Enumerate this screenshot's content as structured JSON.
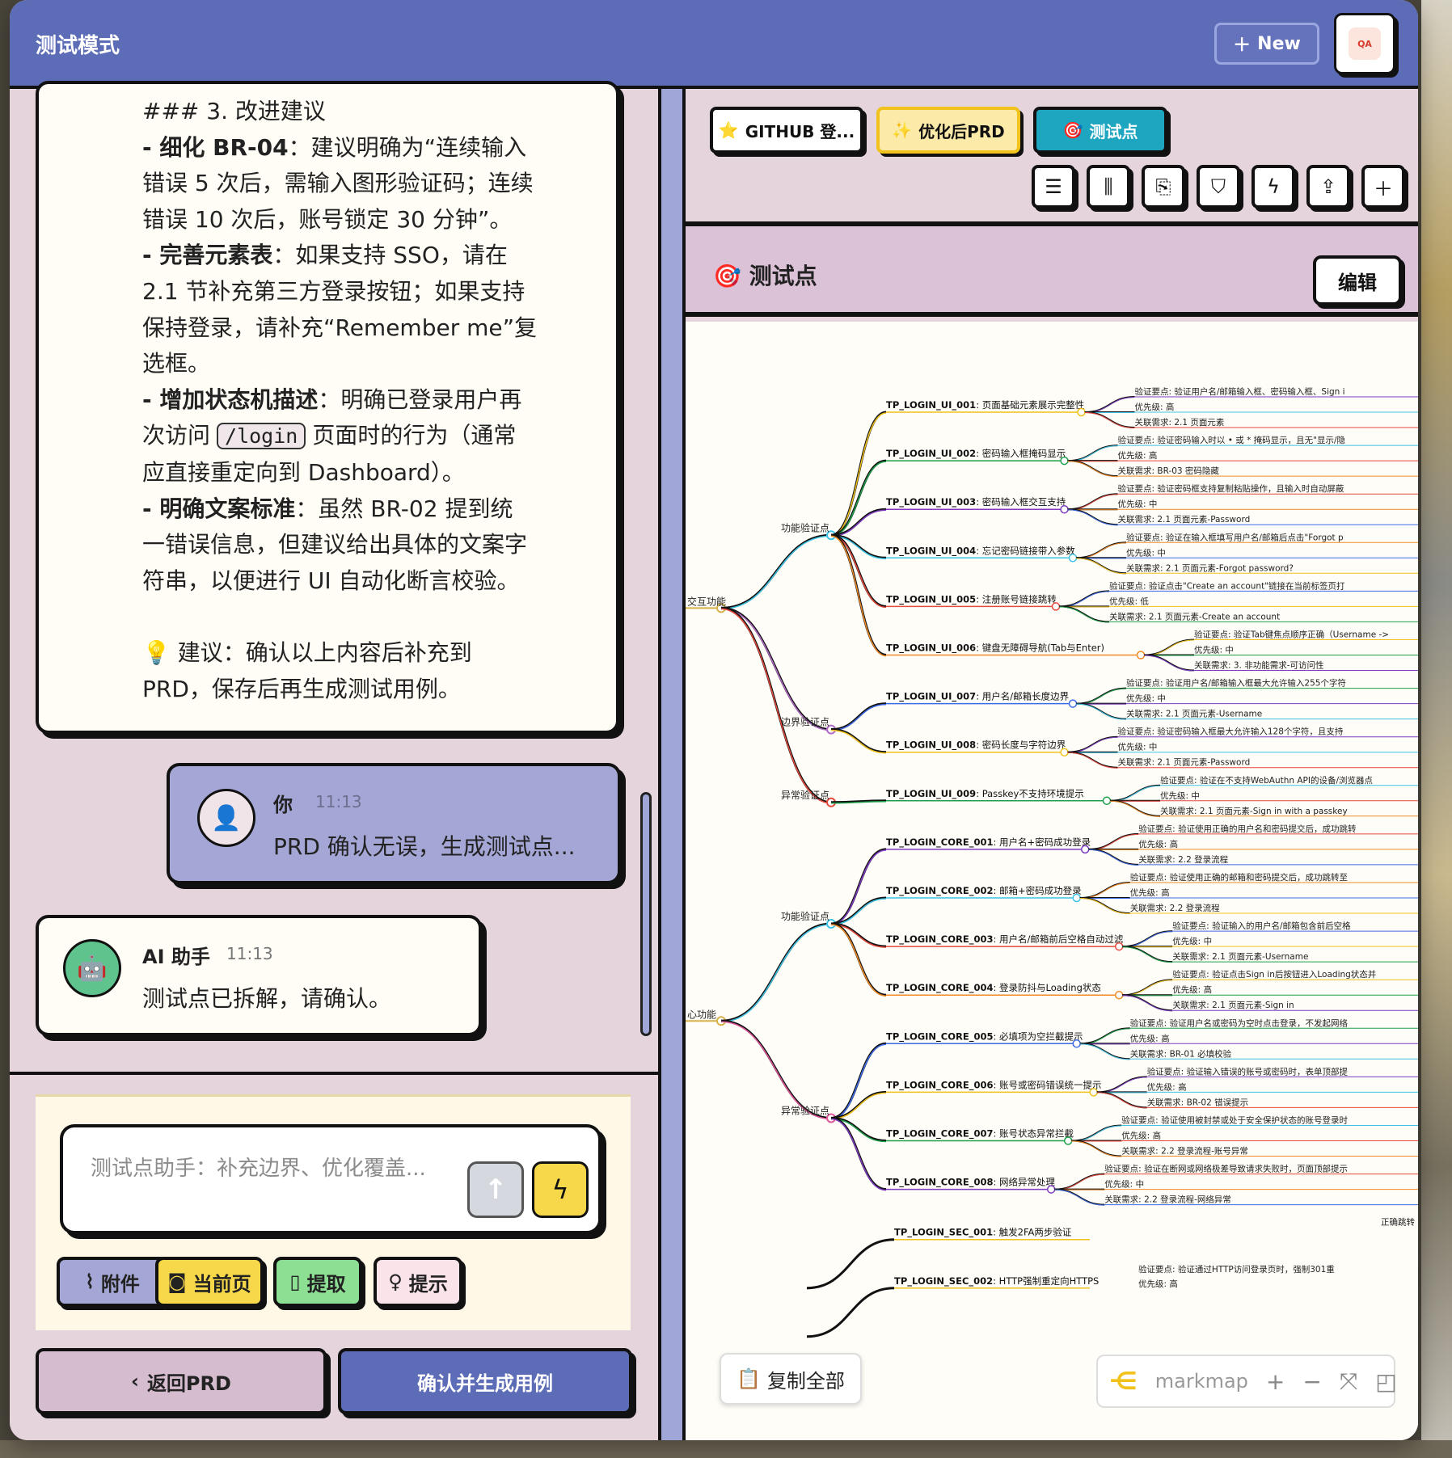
{
  "header": {
    "title": "测试模式",
    "new_label": "New",
    "avatar_text": "QA"
  },
  "chat": {
    "big_message_lines": [
      {
        "bold": "",
        "rest": "### 3. 改进建议"
      },
      {
        "bold": "- 细化 BR-04",
        "rest": "：建议明确为“连续输入"
      },
      {
        "bold": "",
        "rest": "错误 5 次后，需输入图形验证码；连续"
      },
      {
        "bold": "",
        "rest": "错误 10 次后，账号锁定 30 分钟”。"
      },
      {
        "bold": "- 完善元素表",
        "rest": "：如果支持 SSO，请在"
      },
      {
        "bold": "",
        "rest": "2.1 节补充第三方登录按钮；如果支持"
      },
      {
        "bold": "",
        "rest": "保持登录，请补充“Remember me”复"
      },
      {
        "bold": "",
        "rest": "选框。"
      },
      {
        "bold": "- 增加状态机描述",
        "rest": "：明确已登录用户再"
      },
      {
        "bold": "",
        "rest": ""
      },
      {
        "bold": "",
        "rest": "应直接重定向到 Dashboard）。"
      },
      {
        "bold": "- 明确文案标准",
        "rest": "：虽然 BR-02 提到统"
      },
      {
        "bold": "",
        "rest": "一错误信息，但建议给出具体的文案字"
      },
      {
        "bold": "",
        "rest": "符串，以便进行 UI 自动化断言校验。"
      },
      {
        "bold": "",
        "rest": " "
      },
      {
        "bold": "",
        "rest": "💡 建议：确认以上内容后补充到"
      },
      {
        "bold": "",
        "rest": "PRD，保存后再生成测试用例。"
      }
    ],
    "line10_pre": "次访问",
    "line10_code": "/login",
    "line10_post": "页面时的行为（通常",
    "user_message": {
      "name": "你",
      "time": "11:13",
      "text": "PRD 确认无误，生成测试点..."
    },
    "ai_message": {
      "name": "AI 助手",
      "time": "11:13",
      "text": "测试点已拆解，请确认。"
    },
    "composer_placeholder": "测试点助手：补充边界、优化覆盖...",
    "tools": [
      "附件",
      "当前页",
      "提取",
      "提示"
    ],
    "back_label": "返回PRD",
    "confirm_label": "确认并生成用例"
  },
  "right": {
    "tabs": [
      "GITHUB 登...",
      "优化后PRD",
      "测试点"
    ],
    "section_title": "测试点",
    "edit_label": "编辑",
    "copy_all_label": "复制全部",
    "markmap_label": "markmap"
  },
  "mindmap": {
    "groups": [
      {
        "label": "交互功能",
        "categories": [
          {
            "label": "功能验证点",
            "color": "#3cc3e5",
            "nodes": [
              {
                "id": "TP_LOGIN_UI_001",
                "title": "页面基础元素展示完整性",
                "detail": "验证要点: 验证用户名/邮箱输入框、密码输入框、Sign i",
                "priority": "优先级: 高",
                "req": "关联需求: 2.1 页面元素"
              },
              {
                "id": "TP_LOGIN_UI_002",
                "title": "密码输入框掩码显示",
                "detail": "验证要点: 验证密码输入时以 • 或 * 掩码显示，且无\"显示/隐",
                "priority": "优先级: 高",
                "req": "关联需求: BR-03 密码隐藏"
              },
              {
                "id": "TP_LOGIN_UI_003",
                "title": "密码输入框交互支持",
                "detail": "验证要点: 验证密码框支持复制粘贴操作，且输入时自动屏蔽",
                "priority": "优先级: 中",
                "req": "关联需求: 2.1 页面元素-Password"
              },
              {
                "id": "TP_LOGIN_UI_004",
                "title": "忘记密码链接带入参数",
                "detail": "验证要点: 验证在输入框填写用户名/邮箱后点击\"Forgot p",
                "priority": "优先级: 中",
                "req": "关联需求: 2.1 页面元素-Forgot password?"
              },
              {
                "id": "TP_LOGIN_UI_005",
                "title": "注册账号链接跳转",
                "detail": "验证要点: 验证点击\"Create an account\"链接在当前标签页打",
                "priority": "优先级: 低",
                "req": "关联需求: 2.1 页面元素-Create an account"
              },
              {
                "id": "TP_LOGIN_UI_006",
                "title": "键盘无障碍导航(Tab与Enter)",
                "detail": "验证要点: 验证Tab键焦点顺序正确（Username ->",
                "priority": "优先级: 中",
                "req": "关联需求: 3. 非功能需求-可访问性"
              }
            ]
          },
          {
            "label": "边界验证点",
            "color": "#b06ac6",
            "nodes": [
              {
                "id": "TP_LOGIN_UI_007",
                "title": "用户名/邮箱长度边界",
                "detail": "验证要点: 验证用户名/邮箱输入框最大允许输入255个字符",
                "priority": "优先级: 中",
                "req": "关联需求: 2.1 页面元素-Username"
              },
              {
                "id": "TP_LOGIN_UI_008",
                "title": "密码长度与字符边界",
                "detail": "验证要点: 验证密码输入框最大允许输入128个字符，且支持",
                "priority": "优先级: 中",
                "req": "关联需求: 2.1 页面元素-Password"
              }
            ]
          },
          {
            "label": "异常验证点",
            "color": "#e5483c",
            "nodes": [
              {
                "id": "TP_LOGIN_UI_009",
                "title": "Passkey不支持环境提示",
                "detail": "验证要点: 验证在不支持WebAuthn API的设备/浏览器点",
                "priority": "优先级: 中",
                "req": "关联需求: 2.1 页面元素-Sign in with a passkey"
              }
            ]
          }
        ]
      },
      {
        "label": "心功能",
        "categories": [
          {
            "label": "功能验证点",
            "color": "#3cc3e5",
            "nodes": [
              {
                "id": "TP_LOGIN_CORE_001",
                "title": "用户名+密码成功登录",
                "detail": "验证要点: 验证使用正确的用户名和密码提交后，成功跳转",
                "priority": "优先级: 高",
                "req": "关联需求: 2.2 登录流程"
              },
              {
                "id": "TP_LOGIN_CORE_002",
                "title": "邮箱+密码成功登录",
                "detail": "验证要点: 验证使用正确的邮箱和密码提交后，成功跳转至",
                "priority": "优先级: 高",
                "req": "关联需求: 2.2 登录流程"
              },
              {
                "id": "TP_LOGIN_CORE_003",
                "title": "用户名/邮箱前后空格自动过滤",
                "detail": "验证要点: 验证输入的用户名/邮箱包含前后空格",
                "priority": "优先级: 中",
                "req": "关联需求: 2.1 页面元素-Username"
              },
              {
                "id": "TP_LOGIN_CORE_004",
                "title": "登录防抖与Loading状态",
                "detail": "验证要点: 验证点击Sign in后按钮进入Loading状态并",
                "priority": "优先级: 高",
                "req": "关联需求: 2.1 页面元素-Sign in"
              }
            ]
          },
          {
            "label": "异常验证点",
            "color": "#e0569a",
            "nodes": [
              {
                "id": "TP_LOGIN_CORE_005",
                "title": "必填项为空拦截提示",
                "detail": "验证要点: 验证用户名或密码为空时点击登录，不发起网络",
                "priority": "优先级: 高",
                "req": "关联需求: BR-01 必填校验"
              },
              {
                "id": "TP_LOGIN_CORE_006",
                "title": "账号或密码错误统一提示",
                "detail": "验证要点: 验证输入错误的账号或密码时，表单顶部提",
                "priority": "优先级: 高",
                "req": "关联需求: BR-02 错误提示"
              },
              {
                "id": "TP_LOGIN_CORE_007",
                "title": "账号状态异常拦截",
                "detail": "验证要点: 验证使用被封禁或处于安全保护状态的账号登录时",
                "priority": "优先级: 高",
                "req": "关联需求: 2.2 登录流程-账号异常"
              },
              {
                "id": "TP_LOGIN_CORE_008",
                "title": "网络异常处理",
                "detail": "验证要点: 验证在断网或网络极差导致请求失败时，页面顶部提示",
                "priority": "优先级: 中",
                "req": "关联需求: 2.2 登录流程-网络异常"
              }
            ]
          }
        ]
      }
    ],
    "tail_nodes": [
      {
        "id": "TP_LOGIN_SEC_001",
        "title": "触发2FA两步验证",
        "detail": "正确跳转"
      },
      {
        "id": "TP_LOGIN_SEC_002",
        "title": "HTTP强制重定向HTTPS",
        "detail": "验证要点: 验证通过HTTP访问登录页时，强制301重",
        "priority": "优先级: 高"
      }
    ]
  },
  "colors": {
    "header": "#5d6cb6",
    "panel": "#e5d4dc",
    "accent_yellow": "#f7d84a",
    "accent_teal": "#1ea6c0"
  }
}
